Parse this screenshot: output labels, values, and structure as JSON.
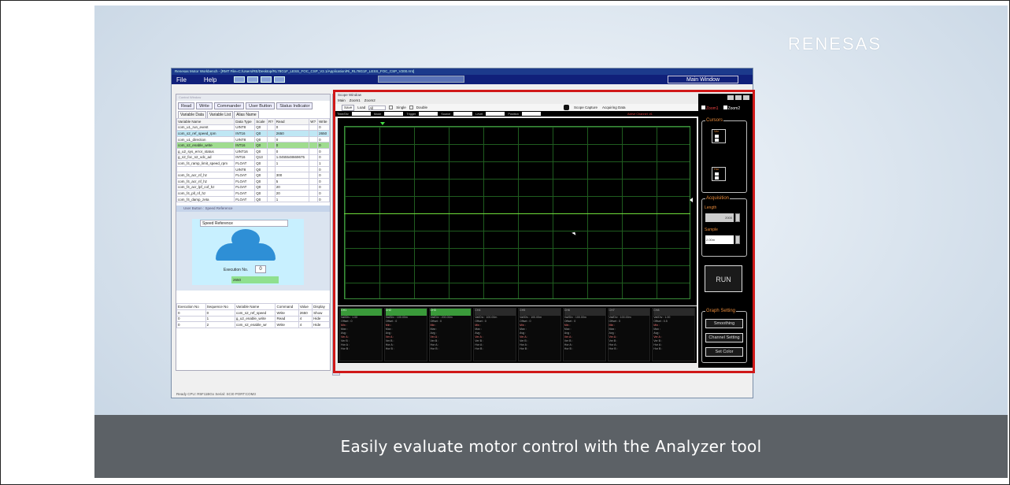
{
  "brand": {
    "logo_text": "RENESAS"
  },
  "caption": {
    "text": "Easily evaluate motor control with the Analyzer tool"
  },
  "app": {
    "title": "Renesas Motor Workbench - [RMT File=C:/Users/RE/Desktop/RL78G1F_LESS_FOC_CSP_V2.1/Application/Ri_RL78G1F_LESS_FOC_CSP_V200.rmt]",
    "menu": {
      "file": "File",
      "help": "Help"
    },
    "analyzer_label": "Analyzer",
    "main_window_label": "Main Window",
    "status": "Ready  CPU: R5F11BGx  Serial: SCI0  PORT:COM3"
  },
  "control_window": {
    "title": "Control Window",
    "buttons": [
      "Read",
      "Write",
      "Commander",
      "User Button",
      "Status Indicator"
    ],
    "tabs": [
      "Variable Data",
      "Variable List",
      "Alias Name"
    ],
    "headers": [
      "Variable Name",
      "Data Type",
      "Scale",
      "R?",
      "Read",
      "W?",
      "Write"
    ],
    "rows": [
      {
        "name": "com_u1_run_event",
        "type": "UINT8",
        "scale": "Q0",
        "read": "0",
        "write": "0",
        "hl": ""
      },
      {
        "name": "com_s2_ref_speed_rpm",
        "type": "INT16",
        "scale": "Q0",
        "read": "2650",
        "write": "2650",
        "hl": "blue"
      },
      {
        "name": "com_u1_direction",
        "type": "UINT8",
        "scale": "Q0",
        "read": "0",
        "write": "0",
        "hl": ""
      },
      {
        "name": "com_s2_enable_write",
        "type": "INT16",
        "scale": "Q0",
        "read": "0",
        "write": "0",
        "hl": "green"
      },
      {
        "name": "g_u2_sys_error_status",
        "type": "UINT16",
        "scale": "Q0",
        "read": "0",
        "write": "0",
        "hl": ""
      },
      {
        "name": "g_s2_foc_s2_vdc_ad",
        "type": "INT16",
        "scale": "Q13",
        "read": "1.0455548669675",
        "write": "0",
        "hl": ""
      },
      {
        "name": "com_f4_ramp_limit_speed_rpm",
        "type": "FLOAT",
        "scale": "Q0",
        "read": "1",
        "write": "1",
        "hl": ""
      },
      {
        "name": "",
        "type": "UINT8",
        "scale": "Q0",
        "read": "",
        "write": "0",
        "hl": ""
      },
      {
        "name": "com_f4_acr_nf_hz",
        "type": "FLOAT",
        "scale": "Q0",
        "read": "300",
        "write": "0",
        "hl": ""
      },
      {
        "name": "com_f4_acr_nf_hz",
        "type": "FLOAT",
        "scale": "Q0",
        "read": "5",
        "write": "0",
        "hl": ""
      },
      {
        "name": "com_f4_acr_lpf_cof_hz",
        "type": "FLOAT",
        "scale": "Q0",
        "read": "20",
        "write": "0",
        "hl": ""
      },
      {
        "name": "com_f4_pll_nf_hz",
        "type": "FLOAT",
        "scale": "Q0",
        "read": "20",
        "write": "0",
        "hl": ""
      },
      {
        "name": "com_f4_damp_zeta",
        "type": "FLOAT",
        "scale": "Q0",
        "read": "1",
        "write": "0",
        "hl": ""
      }
    ]
  },
  "user_button": {
    "title": "User Button : Speed Reference",
    "speed_label": "Speed Reference",
    "exec_label": "Execution No.",
    "exec_value": "0",
    "value_box": "2650",
    "table_headers": [
      "Execution No",
      "Sequence No",
      "Variable Name",
      "Command",
      "Value",
      "Display"
    ],
    "table_rows": [
      [
        "0",
        "0",
        "com_s2_ref_speed",
        "Write",
        "2650",
        "Show"
      ],
      [
        "0",
        "1",
        "g_u2_enable_write",
        "Read",
        "4",
        "Hide"
      ],
      [
        "0",
        "2",
        "com_s2_enable_wr",
        "Write",
        "4",
        "Hide"
      ]
    ]
  },
  "scope": {
    "title": "Scope Window",
    "tabs": [
      "Main",
      "Zoom1",
      "Zoom2"
    ],
    "bar": {
      "save": "Save",
      "load": "Load",
      "load_value": "All",
      "single": "Single",
      "double": "Double",
      "capture": "Scope Capture",
      "acquiring": "Acquiring Data"
    },
    "ctrl": {
      "timediv": "Time/Div",
      "timediv_val": "500.00m",
      "mode": "Mode",
      "mode_val": "Normal",
      "trigger": "Trigger",
      "trigger_val": "Rise",
      "source": "Source",
      "source_val": "CH1",
      "level": "Level",
      "level_val": "300.00m",
      "position": "Position",
      "position_val": "500.00m",
      "active": "Active Channel: #1"
    },
    "channels": [
      {
        "title": "CH1",
        "vd": "Val/Div : 1.00",
        "offset": "Offset : 0",
        "style": "green"
      },
      {
        "title": "CH2",
        "vd": "Val/Div : 100.00m",
        "offset": "Offset : 0",
        "style": "green"
      },
      {
        "title": "CH3",
        "vd": "Val/Div : 200.00m",
        "offset": "Offset : 0",
        "style": "green"
      },
      {
        "title": "CH4",
        "vd": "Val/Div : 100.00m",
        "offset": "Offset : 0",
        "style": "gray"
      },
      {
        "title": "CH5",
        "vd": "Val/Div : 100.00m",
        "offset": "Offset : 0",
        "style": "gray"
      },
      {
        "title": "CH6",
        "vd": "Val/Div : 100.00m",
        "offset": "Offset : 0",
        "style": "gray"
      },
      {
        "title": "CH7",
        "vd": "Val/Div : 100.00m",
        "offset": "Offset : 0",
        "style": "gray"
      },
      {
        "title": "CH8",
        "vd": "Val/Div : 1.00",
        "offset": "Offset : 0.5",
        "style": "gray"
      }
    ],
    "stat_labels": [
      "Min :",
      "Max :",
      "Avg :",
      "Ver A :",
      "Ver B :",
      "Hor A :",
      "Hor B :"
    ],
    "right": {
      "zoom1": "Zoom1",
      "zoom2": "Zoom2",
      "cursors": "Cursors",
      "ver": "Ver",
      "hor": "Hor",
      "acquisition": "Acquisition",
      "length": "Length",
      "length_val": "2000",
      "sample": "Sample",
      "sample_val": "2.00m",
      "run": "RUN",
      "graph_setting": "Graph Setting",
      "smoothing": "Smoothing",
      "channel_setting": "Channel Setting",
      "set_color": "Set Color"
    }
  }
}
